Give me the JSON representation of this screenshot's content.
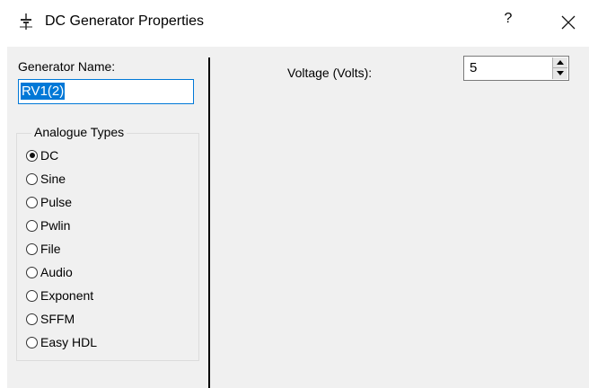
{
  "window": {
    "title": "DC Generator Properties",
    "help_label": "?",
    "icons": {
      "app": "dc-generator-icon",
      "close": "close-icon"
    }
  },
  "generator": {
    "name_label": "Generator Name:",
    "name_value": "RV1(2)"
  },
  "analogue_types": {
    "legend": "Analogue Types",
    "selected": "DC",
    "options": [
      "DC",
      "Sine",
      "Pulse",
      "Pwlin",
      "File",
      "Audio",
      "Exponent",
      "SFFM",
      "Easy HDL"
    ]
  },
  "voltage": {
    "label": "Voltage (Volts):",
    "value": "5"
  },
  "colors": {
    "selection": "#0078d7",
    "panel": "#f0f0f0",
    "window": "#ffffff"
  }
}
